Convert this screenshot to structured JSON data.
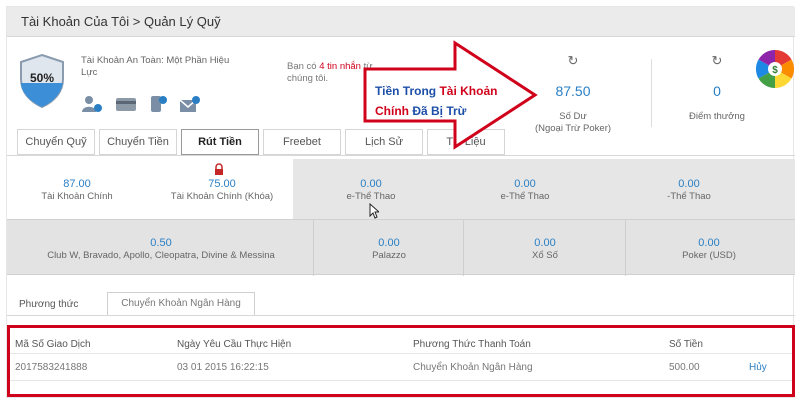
{
  "breadcrumb": "Tài Khoản Của Tôi > Quản Lý Quỹ",
  "shield": {
    "percent": "50%",
    "icon": "shield-icon"
  },
  "account_status": "Tài Khoản An Toàn: Một Phần Hiệu Lực",
  "verify_icons": [
    "user-verified-icon",
    "card-icon",
    "phone-verified-icon",
    "email-verified-icon"
  ],
  "message": {
    "prefix": "Bạn có ",
    "count": "4 tin nhắn",
    "suffix": " từ chúng tôi."
  },
  "balance": {
    "value": "87.50",
    "label": "Số Dư",
    "sublabel": "(Ngoại Trừ Poker)"
  },
  "points": {
    "value": "0",
    "label": "Điểm thưởng"
  },
  "wheel_label": "$",
  "tabs": [
    "Chuyển Quỹ",
    "Chuyển Tiền",
    "Rút Tiền",
    "Freebet",
    "Lịch Sử",
    "Tài Liệu"
  ],
  "active_tab": "Rút Tiền",
  "sub_accounts_row1": [
    {
      "value": "87.00",
      "label": "Tài Khoản Chính"
    },
    {
      "value": "75.00",
      "label": "Tài Khoản Chính (Khóa)"
    },
    {
      "value": "0.00",
      "label": "e-Thể Thao"
    },
    {
      "value": "0.00",
      "label": "e-Thể Thao"
    },
    {
      "value": "0.00",
      "label": "-Thể Thao"
    }
  ],
  "sub_accounts_row2": [
    {
      "value": "0.50",
      "label": "Club W, Bravado, Apollo, Cleopatra, Divine & Messina"
    },
    {
      "value": "0.00",
      "label": "Palazzo"
    },
    {
      "value": "0.00",
      "label": "Xổ Số"
    },
    {
      "value": "0.00",
      "label": "Poker (USD)"
    }
  ],
  "method": {
    "label": "Phương thức",
    "value": "Chuyển Khoản Ngân Hàng"
  },
  "table": {
    "headers": [
      "Mã Số Giao Dịch",
      "Ngày Yêu Cầu Thực Hiện",
      "Phương Thức Thanh Toán",
      "Số Tiền"
    ],
    "rows": [
      {
        "id": "2017583241888",
        "date": "03 01 2015 16:22:15",
        "method": "Chuyển Khoản Ngân Hàng",
        "amount": "500.00",
        "action": "Hủy"
      }
    ]
  },
  "annotation": {
    "line1_blue": "Tiền Trong ",
    "line1_red": "Tài Khoản",
    "line2_red": "Chính",
    "line2_blue": " Đã Bị Trừ"
  },
  "colors": {
    "accent_blue": "#2a7fc4",
    "annotation_red": "#d0021b",
    "header_grey": "#ebebeb"
  }
}
